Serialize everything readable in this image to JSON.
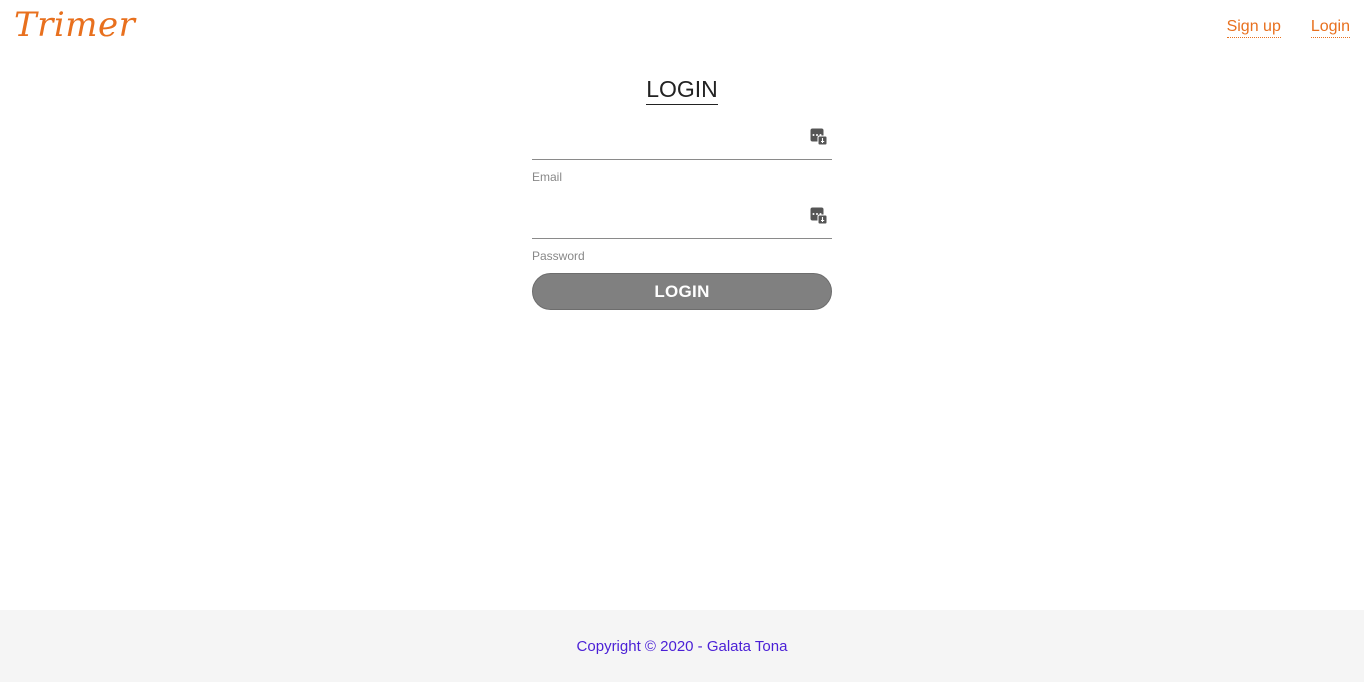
{
  "header": {
    "logo": "Trimer",
    "nav": [
      {
        "label": "Sign up"
      },
      {
        "label": "Login"
      }
    ]
  },
  "main": {
    "title": "LOGIN",
    "fields": [
      {
        "label": "Email",
        "value": "",
        "icon": "password-manager-icon"
      },
      {
        "label": "Password",
        "value": "",
        "icon": "password-manager-icon"
      }
    ],
    "submit_label": "LOGIN"
  },
  "footer": {
    "text": "Copyright © 2020 - Galata Tona"
  },
  "colors": {
    "brand": "#e8701e",
    "button": "#808080",
    "footer_text": "#4a1fd6",
    "footer_bg": "#f5f5f5"
  }
}
